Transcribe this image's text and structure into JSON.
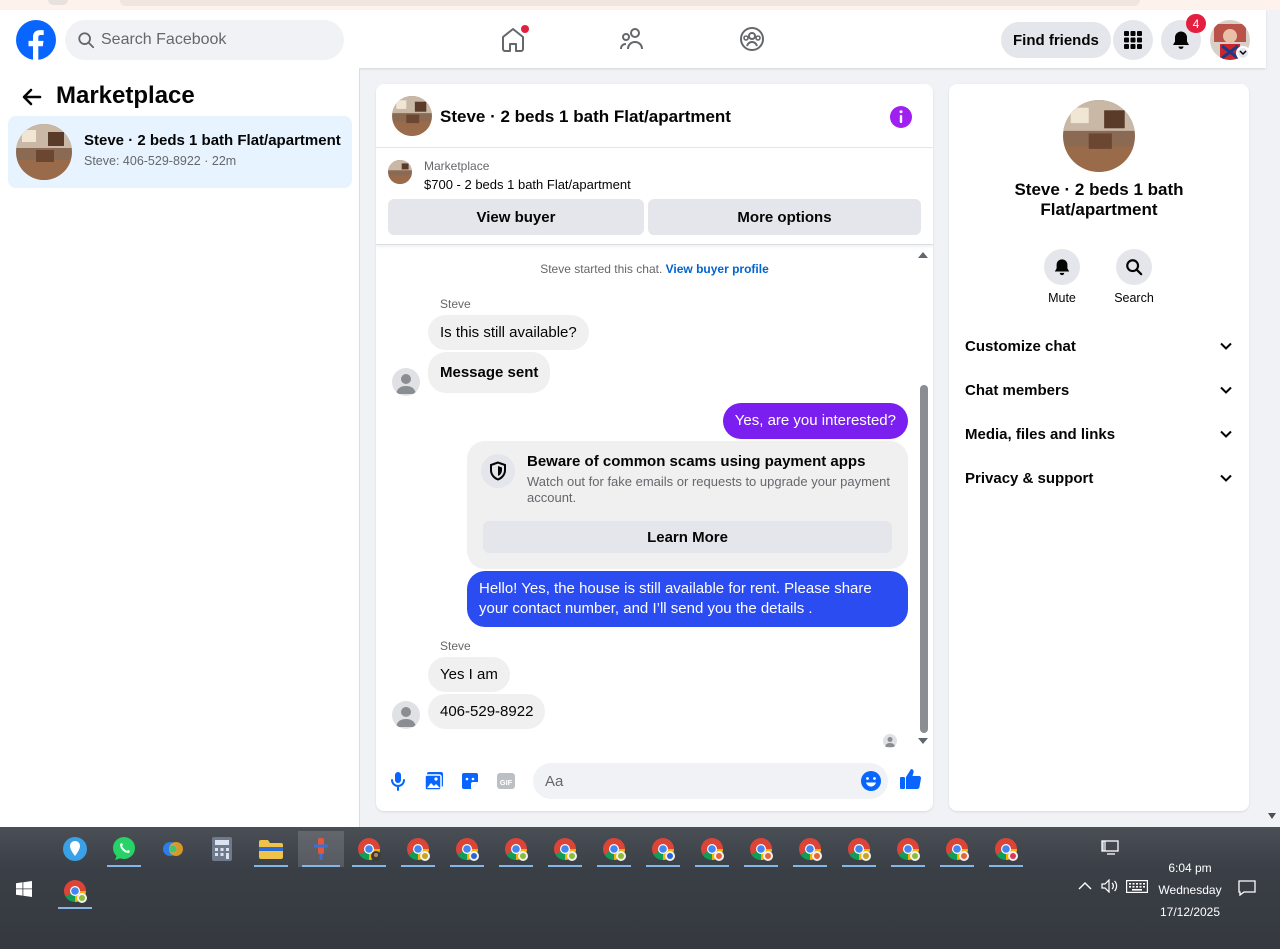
{
  "nav": {
    "search_placeholder": "Search Facebook",
    "find_friends": "Find friends",
    "notification_count": "4"
  },
  "sidebar": {
    "title": "Marketplace",
    "conversation": {
      "name": "Steve · 2 beds 1 bath Flat/apartment",
      "preview": "Steve: 406-529-8922 · 22m"
    }
  },
  "chat": {
    "title": "Steve · 2 beds 1 bath Flat/apartment",
    "listing_label": "Marketplace",
    "listing_price": "$700 - 2 beds 1 bath Flat/apartment",
    "view_buyer": "View buyer",
    "more_options": "More options",
    "started_text": "Steve started this chat.",
    "started_link": "View buyer profile",
    "messages": [
      {
        "sender": "Steve"
      },
      {
        "text": "Is this still available?"
      },
      {
        "text": "Message sent"
      },
      {
        "text": "Yes, are you interested?"
      },
      {
        "text": "Hello! Yes, the house is still available for rent. Please share your contact number, and I’ll send you the details ."
      },
      {
        "sender": "Steve"
      },
      {
        "text": "Yes I am"
      },
      {
        "text": "406-529-8922"
      }
    ],
    "warning": {
      "title": "Beware of common scams using payment apps",
      "text": "Watch out for fake emails or requests to upgrade your payment account.",
      "button": "Learn More"
    },
    "composer_placeholder": "Aa"
  },
  "details": {
    "title": "Steve · 2 beds 1 bath Flat/apartment",
    "mute": "Mute",
    "search": "Search",
    "sections": [
      "Customize chat",
      "Chat members",
      "Media, files and links",
      "Privacy & support"
    ]
  },
  "taskbar": {
    "time": "6:04 pm",
    "day": "Wednesday",
    "date": "17/12/2025"
  },
  "colors": {
    "facebook_blue": "#0866ff",
    "outgoing_purple": "#7a1ff0",
    "outgoing_blue": "#2a4cf0",
    "info_purple": "#a020f0",
    "badge_red": "#e41e3f"
  }
}
